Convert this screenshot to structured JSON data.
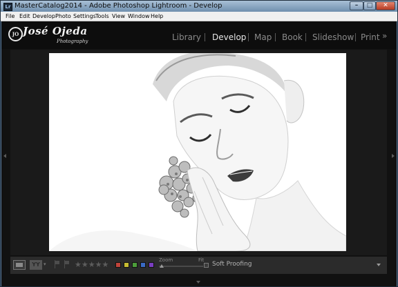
{
  "window": {
    "title": "MasterCatalog2014 - Adobe Photoshop Lightroom - Develop",
    "app_icon": "Lr",
    "controls": {
      "minimize": "–",
      "maximize": "□",
      "close": "✕"
    }
  },
  "menu": [
    "File",
    "Edit",
    "Develop",
    "Photo",
    "Settings",
    "Tools",
    "View",
    "Window",
    "Help"
  ],
  "identity_plate": {
    "monogram": "JO",
    "name": "José Ojeda",
    "tagline": "Photography"
  },
  "modules": [
    {
      "label": "Library",
      "active": false
    },
    {
      "label": "Develop",
      "active": true
    },
    {
      "label": "Map",
      "active": false
    },
    {
      "label": "Book",
      "active": false
    },
    {
      "label": "Slideshow",
      "active": false
    },
    {
      "label": "Print",
      "active": false
    }
  ],
  "module_more": "»",
  "toolbar": {
    "view_compare_label": "YY",
    "view_caret": "▾",
    "rating_stars": "★★★★★",
    "color_labels": [
      {
        "name": "red",
        "color": "#c0443a"
      },
      {
        "name": "yellow",
        "color": "#c7bd32"
      },
      {
        "name": "green",
        "color": "#4c9e3a"
      },
      {
        "name": "blue",
        "color": "#3a6bc4"
      },
      {
        "name": "purple",
        "color": "#7a3ec0"
      }
    ],
    "zoom_label": "Zoom",
    "zoom_fit": "Fit",
    "soft_proofing": "Soft Proofing"
  },
  "colors": {
    "title_bar": "#6f8fae",
    "panel_bg": "#111111",
    "active_module": "#e6e6e6",
    "inactive_module": "#8a8a8a"
  }
}
